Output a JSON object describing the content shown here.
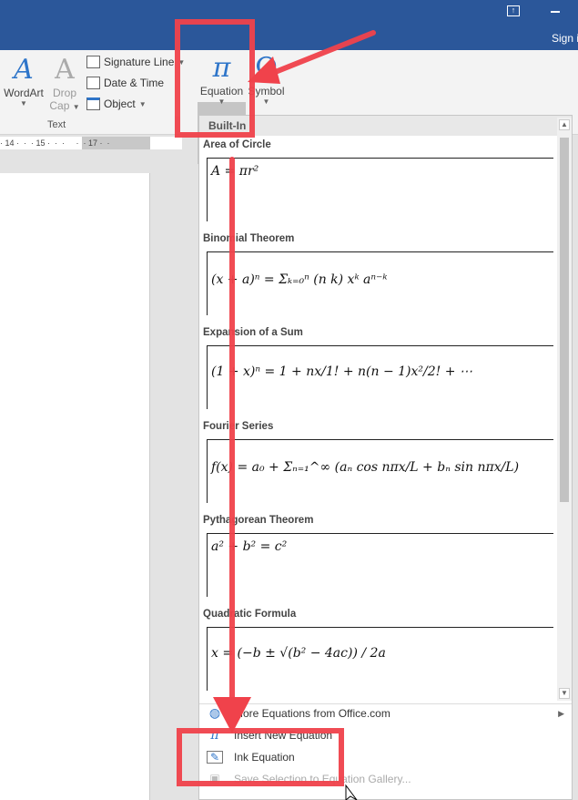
{
  "titlebar": {
    "sign_in": "Sign i",
    "restore_icon": "ribbon-display-icon",
    "minimize_icon": "minimize-icon"
  },
  "ribbon": {
    "wordart": "WordArt",
    "drop_cap_1": "Drop",
    "drop_cap_2": "Cap",
    "signature_line": "Signature Line",
    "date_time": "Date & Time",
    "object": "Object",
    "group_text": "Text",
    "equation": "Equation",
    "symbol": "Symbol",
    "equation_glyph": "π",
    "symbol_glyph": "Ω",
    "wordart_glyph": "A",
    "dropcap_glyph": "A"
  },
  "ruler": {
    "text": "· 14 ·  ·  · 15 ·  ·  ·     ·  · 17 ·  ·"
  },
  "panel": {
    "header": "Built-In",
    "items": [
      {
        "title": "Area of Circle",
        "formula": "A = πr²"
      },
      {
        "title": "Binomial Theorem",
        "formula": "(x + a)ⁿ = Σₖ₌₀ⁿ (n k) xᵏ aⁿ⁻ᵏ"
      },
      {
        "title": "Expansion of a Sum",
        "formula": "(1 + x)ⁿ = 1 + nx/1! + n(n − 1)x²/2! + ⋯"
      },
      {
        "title": "Fourier Series",
        "formula": "f(x) = a₀ + Σₙ₌₁^∞ (aₙ cos nπx/L + bₙ sin nπx/L)"
      },
      {
        "title": "Pythagorean Theorem",
        "formula": "a² + b² = c²"
      },
      {
        "title": "Quadratic Formula",
        "formula": "x = (−b ± √(b² − 4ac)) / 2a"
      }
    ],
    "menu": [
      {
        "label": "More Equations from Office.com",
        "icon": "office-globe-icon",
        "enabled": true,
        "submenu": true
      },
      {
        "label": "Insert New Equation",
        "icon": "pi-icon",
        "enabled": true
      },
      {
        "label": "Ink Equation",
        "icon": "ink-pen-icon",
        "enabled": true
      },
      {
        "label": "Save Selection to Equation Gallery...",
        "icon": "save-equation-icon",
        "enabled": false
      }
    ]
  },
  "colors": {
    "title_bar": "#2b579a",
    "annotation": "#f0424b",
    "accent_icon": "#2e75c9"
  }
}
